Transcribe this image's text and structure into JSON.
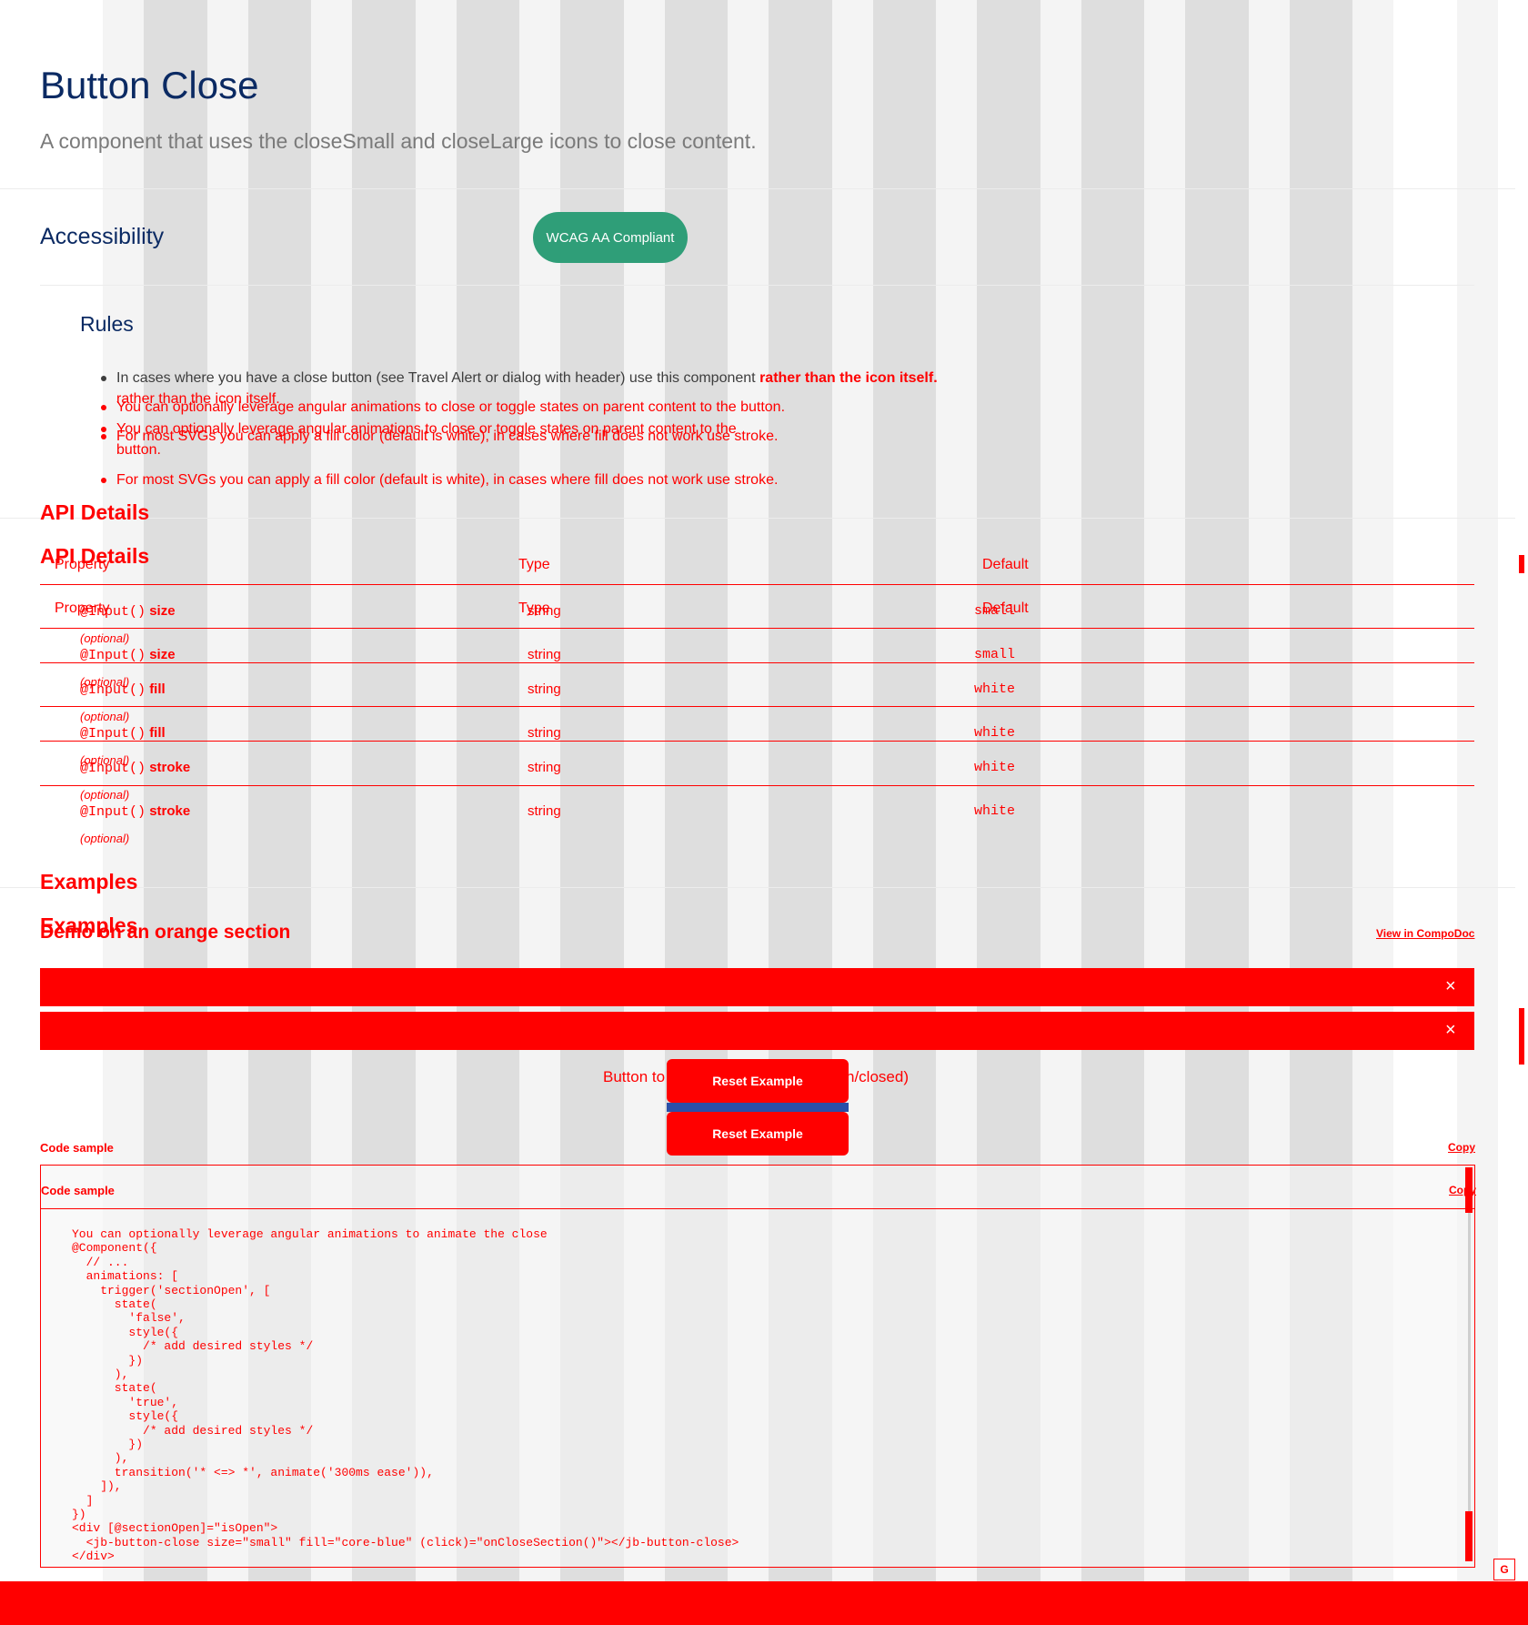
{
  "header": {
    "title": "Button Close",
    "subtitle": "A component that uses the closeSmall and closeLarge icons to close content."
  },
  "accessibility": {
    "title": "Accessibility",
    "badge": "WCAG AA Compliant"
  },
  "rules": {
    "title": "Rules",
    "items": [
      {
        "text": "In cases where you have a close button (see Travel Alert or dialog with header) use this component ",
        "emphasis": "rather than the icon itself."
      },
      {
        "text": "rather than the icon itself."
      },
      {
        "text": "You can optionally leverage angular animations to close or toggle states on parent content to the button."
      },
      {
        "text": "You can optionally leverage angular animations to close or toggle states on parent content to the"
      },
      {
        "text": "button."
      },
      {
        "text": "For most SVGs you can apply a fill color (default is white), in cases where fill does not work use stroke."
      },
      {
        "text": "For most SVGs you can apply a fill color (default is white), in cases where fill does not work use stroke."
      }
    ]
  },
  "api": {
    "title": "API Details",
    "headers": {
      "property": "Property",
      "type": "Type",
      "default": "Default"
    },
    "rows": [
      {
        "decorator": "@Input()",
        "name": "size",
        "optional": "(optional)",
        "type": "string",
        "default": "small"
      },
      {
        "decorator": "@Input()",
        "name": "size",
        "optional": "(optional)",
        "type": "string",
        "default": "small"
      },
      {
        "decorator": "@Input()",
        "name": "fill",
        "optional": "(optional)",
        "type": "string",
        "default": "white"
      },
      {
        "decorator": "@Input()",
        "name": "fill",
        "optional": "(optional)",
        "type": "string",
        "default": "white"
      },
      {
        "decorator": "@Input()",
        "name": "stroke",
        "optional": "(optional)",
        "type": "string",
        "default": "white"
      },
      {
        "decorator": "@Input()",
        "name": "stroke",
        "optional": "(optional)",
        "type": "string",
        "default": "white"
      }
    ]
  },
  "examples": {
    "title": "Examples",
    "demo_title": "Demo on an orange section",
    "view_link": "View in CompoDoc",
    "close_glyph": "×",
    "toggle_text_left": "Button to",
    "toggle_text_right": "n/closed)",
    "reset_label": "Reset Example"
  },
  "code": {
    "label": "Code sample",
    "copy": "Copy",
    "lines": [
      "You can optionally leverage angular animations to animate the close",
      "@Component({",
      "  // ...",
      "  animations: [",
      "    trigger('sectionOpen', [",
      "      state(",
      "        'false',",
      "        style({",
      "          /* add desired styles */",
      "        })",
      "      ),",
      "      state(",
      "        'true',",
      "        style({",
      "          /* add desired styles */",
      "        })",
      "      ),",
      "      transition('* <=> *', animate('300ms ease')),",
      "    ]),",
      "  ]",
      "})",
      "<div [@sectionOpen]=\"isOpen\">",
      "  <jb-button-close size=\"small\" fill=\"core-blue\" (click)=\"onCloseSection()\"></jb-button-close>",
      "</div>"
    ]
  },
  "colors": {
    "navy": "#0b2a63",
    "green_badge": "#2f9e78",
    "overlay_red": "#ff0000"
  },
  "misc": {
    "g_badge": "G"
  }
}
